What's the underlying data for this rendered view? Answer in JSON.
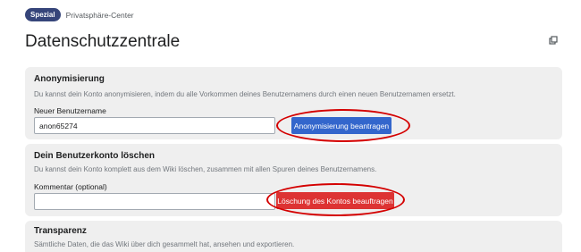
{
  "breadcrumb": {
    "badge": "Spezial",
    "page": "Privatsphäre-Center"
  },
  "page": {
    "title": "Datenschutzzentrale"
  },
  "icons": {
    "popout": "external-popout-icon"
  },
  "anonymization": {
    "title": "Anonymisierung",
    "description": "Du kannst dein Konto anonymisieren, indem du alle Vorkommen deines Benutzernamens durch einen neuen Benutzernamen ersetzt.",
    "field_label": "Neuer Benutzername",
    "field_value": "anon65274",
    "button_label": "Anonymisierung beantragen"
  },
  "deletion": {
    "title": "Dein Benutzerkonto löschen",
    "description": "Du kannst dein Konto komplett aus dem Wiki löschen, zusammen mit allen Spuren deines Benutzernamens.",
    "field_label": "Kommentar (optional)",
    "field_value": "",
    "button_label": "Löschung des Kontos beauftragen"
  },
  "transparency": {
    "title": "Transparenz",
    "description": "Sämtliche Daten, die das Wiki über dich gesammelt hat, ansehen und exportieren."
  },
  "colors": {
    "badge": "#36457a",
    "primary_button": "#3366cc",
    "destructive_button": "#dd3333",
    "annotation_ellipse": "#d40000"
  }
}
